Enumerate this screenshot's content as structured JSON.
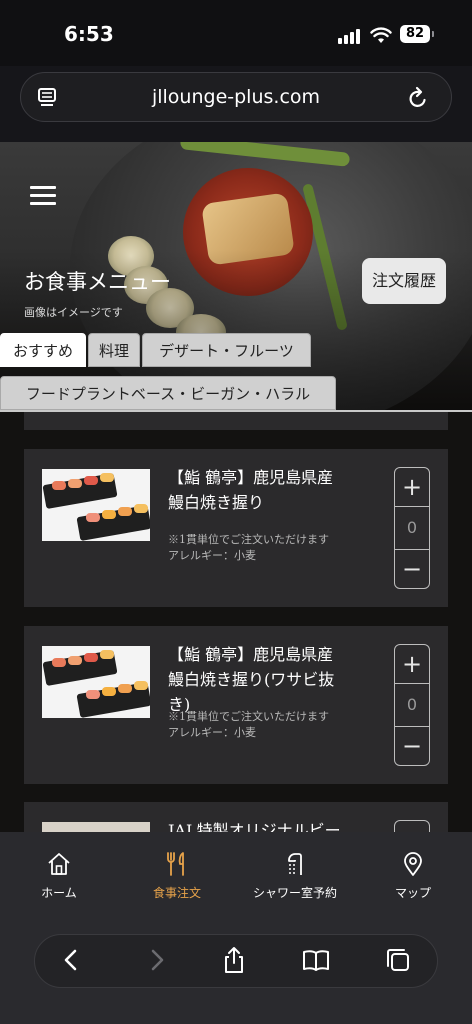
{
  "status_bar": {
    "time": "6:53",
    "battery": "82"
  },
  "browser": {
    "url": "jllounge-plus.com"
  },
  "header": {
    "title": "お食事メニュー",
    "note": "画像はイメージです",
    "history_button": "注文履歴"
  },
  "tabs": [
    {
      "label": "おすすめ",
      "active": true
    },
    {
      "label": "料理",
      "active": false
    },
    {
      "label": "デザート・フルーツ",
      "active": false
    },
    {
      "label": "フードプラントベース・ビーガン・ハラル",
      "active": false
    }
  ],
  "items": [
    {
      "name": "【鮨 鶴亭】鹿児島県産 鰻白焼き握り",
      "note1": "※1貫単位でご注文いただけます",
      "note2": "アレルギー：小麦",
      "quantity": "0"
    },
    {
      "name": "【鮨 鶴亭】鹿児島県産 鰻白焼き握り(ワサビ抜き)",
      "note1": "※1貫単位でご注文いただけます",
      "note2": "アレルギー：小麦",
      "quantity": "0"
    },
    {
      "name": "JAL特製オリジナルビーフ"
    }
  ],
  "stepper": {
    "plus": "+",
    "minus": "−"
  },
  "bottom_nav": [
    {
      "label": "ホーム",
      "icon": "home-icon",
      "active": false
    },
    {
      "label": "食事注文",
      "icon": "fork-knife-icon",
      "active": true
    },
    {
      "label": "シャワー室予約",
      "icon": "shower-icon",
      "active": false
    },
    {
      "label": "マップ",
      "icon": "map-pin-icon",
      "active": false
    }
  ],
  "colors": {
    "accent": "#e6a24a",
    "background": "#16161a",
    "card": "#2b2a2c"
  }
}
